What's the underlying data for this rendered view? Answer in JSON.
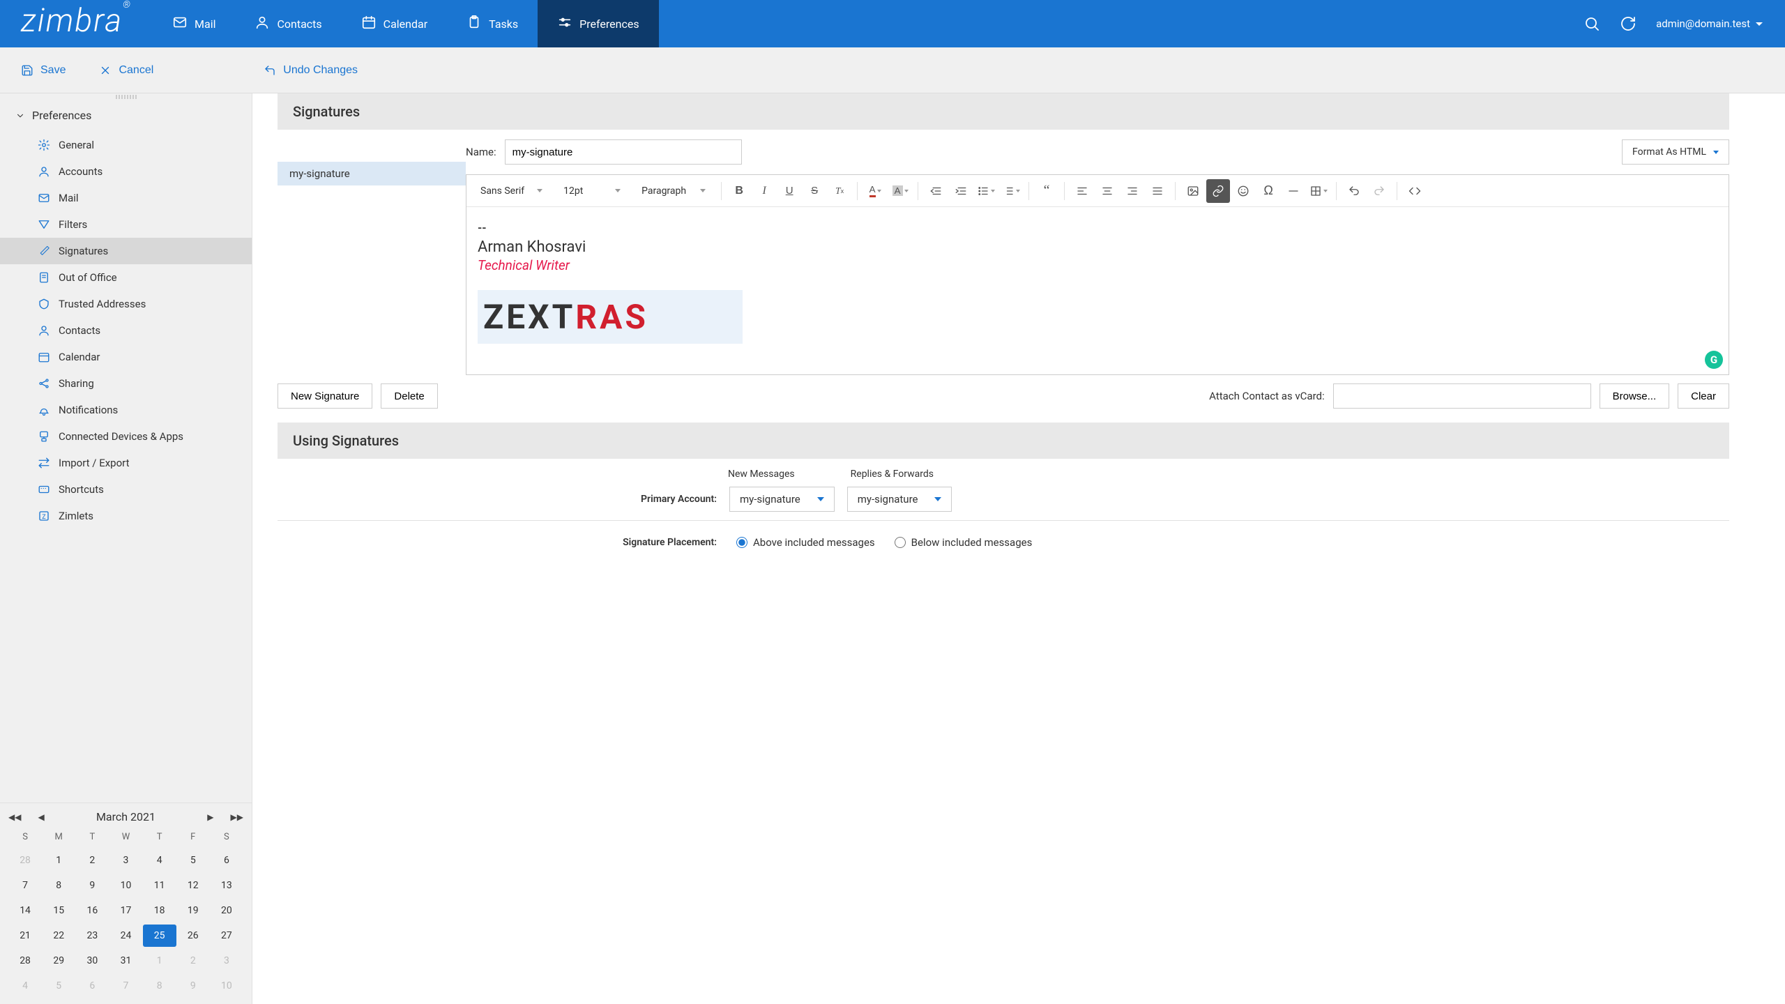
{
  "brand": "zimbra",
  "top_tabs": [
    {
      "icon": "mail",
      "label": "Mail"
    },
    {
      "icon": "contacts",
      "label": "Contacts"
    },
    {
      "icon": "calendar",
      "label": "Calendar"
    },
    {
      "icon": "tasks",
      "label": "Tasks"
    },
    {
      "icon": "preferences",
      "label": "Preferences"
    }
  ],
  "user_email": "admin@domain.test",
  "actions": {
    "save": "Save",
    "cancel": "Cancel",
    "undo": "Undo Changes"
  },
  "sidebar": {
    "root": "Preferences",
    "items": [
      {
        "label": "General"
      },
      {
        "label": "Accounts"
      },
      {
        "label": "Mail"
      },
      {
        "label": "Filters"
      },
      {
        "label": "Signatures"
      },
      {
        "label": "Out of Office"
      },
      {
        "label": "Trusted Addresses"
      },
      {
        "label": "Contacts"
      },
      {
        "label": "Calendar"
      },
      {
        "label": "Sharing"
      },
      {
        "label": "Notifications"
      },
      {
        "label": "Connected Devices & Apps"
      },
      {
        "label": "Import / Export"
      },
      {
        "label": "Shortcuts"
      },
      {
        "label": "Zimlets"
      }
    ]
  },
  "sections": {
    "signatures": "Signatures",
    "using": "Using Signatures"
  },
  "name_label": "Name:",
  "name_value": "my-signature",
  "format_label": "Format As HTML",
  "sig_list_selected": "my-signature",
  "editor": {
    "font": "Sans Serif",
    "size": "12pt",
    "para": "Paragraph",
    "content": {
      "dash": "--",
      "name": "Arman Khosravi",
      "title": "Technical Writer",
      "logo": "ZEXTRAS"
    }
  },
  "logo_letters": [
    "Z",
    "E",
    "X",
    "T",
    "R",
    "A",
    "S"
  ],
  "buttons": {
    "new_sig": "New Signature",
    "delete": "Delete",
    "browse": "Browse...",
    "clear": "Clear"
  },
  "vcard_label": "Attach Contact as vCard:",
  "using": {
    "col_new": "New Messages",
    "col_reply": "Replies & Forwards",
    "row_label": "Primary Account:",
    "sel_new": "my-signature",
    "sel_reply": "my-signature"
  },
  "placement": {
    "label": "Signature Placement:",
    "above": "Above included messages",
    "below": "Below included messages"
  },
  "calendar": {
    "title": "March 2021",
    "days": [
      "S",
      "M",
      "T",
      "W",
      "T",
      "F",
      "S"
    ],
    "weeks": [
      [
        {
          "d": "28",
          "o": true
        },
        {
          "d": "1"
        },
        {
          "d": "2"
        },
        {
          "d": "3"
        },
        {
          "d": "4"
        },
        {
          "d": "5"
        },
        {
          "d": "6"
        }
      ],
      [
        {
          "d": "7"
        },
        {
          "d": "8"
        },
        {
          "d": "9"
        },
        {
          "d": "10"
        },
        {
          "d": "11"
        },
        {
          "d": "12"
        },
        {
          "d": "13"
        }
      ],
      [
        {
          "d": "14"
        },
        {
          "d": "15"
        },
        {
          "d": "16"
        },
        {
          "d": "17"
        },
        {
          "d": "18"
        },
        {
          "d": "19"
        },
        {
          "d": "20"
        }
      ],
      [
        {
          "d": "21"
        },
        {
          "d": "22"
        },
        {
          "d": "23"
        },
        {
          "d": "24"
        },
        {
          "d": "25",
          "t": true
        },
        {
          "d": "26"
        },
        {
          "d": "27"
        }
      ],
      [
        {
          "d": "28"
        },
        {
          "d": "29"
        },
        {
          "d": "30"
        },
        {
          "d": "31"
        },
        {
          "d": "1",
          "o": true
        },
        {
          "d": "2",
          "o": true
        },
        {
          "d": "3",
          "o": true
        }
      ],
      [
        {
          "d": "4",
          "o": true
        },
        {
          "d": "5",
          "o": true
        },
        {
          "d": "6",
          "o": true
        },
        {
          "d": "7",
          "o": true
        },
        {
          "d": "8",
          "o": true
        },
        {
          "d": "9",
          "o": true
        },
        {
          "d": "10",
          "o": true
        }
      ]
    ]
  }
}
